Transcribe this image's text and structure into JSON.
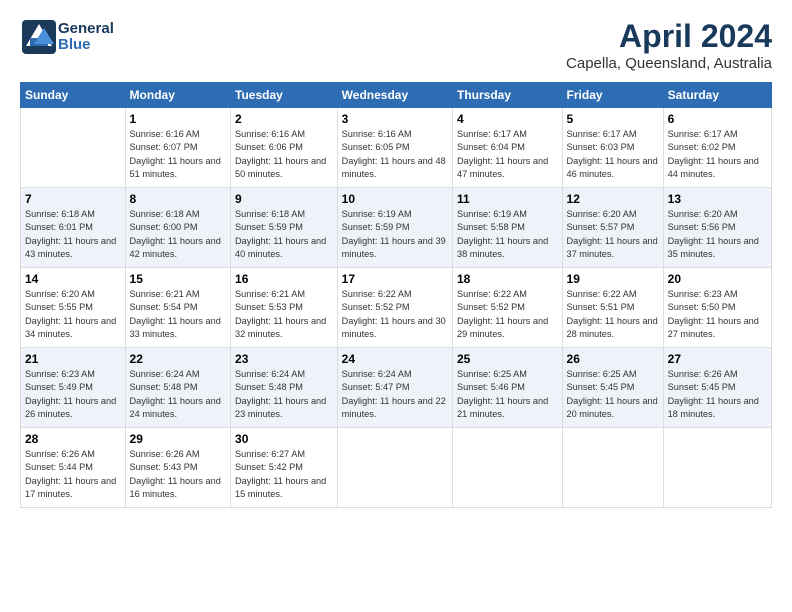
{
  "header": {
    "logo_line1": "General",
    "logo_line2": "Blue",
    "month": "April 2024",
    "location": "Capella, Queensland, Australia"
  },
  "days_of_week": [
    "Sunday",
    "Monday",
    "Tuesday",
    "Wednesday",
    "Thursday",
    "Friday",
    "Saturday"
  ],
  "weeks": [
    [
      {
        "num": "",
        "empty": true
      },
      {
        "num": "1",
        "sunrise": "Sunrise: 6:16 AM",
        "sunset": "Sunset: 6:07 PM",
        "daylight": "Daylight: 11 hours and 51 minutes."
      },
      {
        "num": "2",
        "sunrise": "Sunrise: 6:16 AM",
        "sunset": "Sunset: 6:06 PM",
        "daylight": "Daylight: 11 hours and 50 minutes."
      },
      {
        "num": "3",
        "sunrise": "Sunrise: 6:16 AM",
        "sunset": "Sunset: 6:05 PM",
        "daylight": "Daylight: 11 hours and 48 minutes."
      },
      {
        "num": "4",
        "sunrise": "Sunrise: 6:17 AM",
        "sunset": "Sunset: 6:04 PM",
        "daylight": "Daylight: 11 hours and 47 minutes."
      },
      {
        "num": "5",
        "sunrise": "Sunrise: 6:17 AM",
        "sunset": "Sunset: 6:03 PM",
        "daylight": "Daylight: 11 hours and 46 minutes."
      },
      {
        "num": "6",
        "sunrise": "Sunrise: 6:17 AM",
        "sunset": "Sunset: 6:02 PM",
        "daylight": "Daylight: 11 hours and 44 minutes."
      }
    ],
    [
      {
        "num": "7",
        "sunrise": "Sunrise: 6:18 AM",
        "sunset": "Sunset: 6:01 PM",
        "daylight": "Daylight: 11 hours and 43 minutes."
      },
      {
        "num": "8",
        "sunrise": "Sunrise: 6:18 AM",
        "sunset": "Sunset: 6:00 PM",
        "daylight": "Daylight: 11 hours and 42 minutes."
      },
      {
        "num": "9",
        "sunrise": "Sunrise: 6:18 AM",
        "sunset": "Sunset: 5:59 PM",
        "daylight": "Daylight: 11 hours and 40 minutes."
      },
      {
        "num": "10",
        "sunrise": "Sunrise: 6:19 AM",
        "sunset": "Sunset: 5:59 PM",
        "daylight": "Daylight: 11 hours and 39 minutes."
      },
      {
        "num": "11",
        "sunrise": "Sunrise: 6:19 AM",
        "sunset": "Sunset: 5:58 PM",
        "daylight": "Daylight: 11 hours and 38 minutes."
      },
      {
        "num": "12",
        "sunrise": "Sunrise: 6:20 AM",
        "sunset": "Sunset: 5:57 PM",
        "daylight": "Daylight: 11 hours and 37 minutes."
      },
      {
        "num": "13",
        "sunrise": "Sunrise: 6:20 AM",
        "sunset": "Sunset: 5:56 PM",
        "daylight": "Daylight: 11 hours and 35 minutes."
      }
    ],
    [
      {
        "num": "14",
        "sunrise": "Sunrise: 6:20 AM",
        "sunset": "Sunset: 5:55 PM",
        "daylight": "Daylight: 11 hours and 34 minutes."
      },
      {
        "num": "15",
        "sunrise": "Sunrise: 6:21 AM",
        "sunset": "Sunset: 5:54 PM",
        "daylight": "Daylight: 11 hours and 33 minutes."
      },
      {
        "num": "16",
        "sunrise": "Sunrise: 6:21 AM",
        "sunset": "Sunset: 5:53 PM",
        "daylight": "Daylight: 11 hours and 32 minutes."
      },
      {
        "num": "17",
        "sunrise": "Sunrise: 6:22 AM",
        "sunset": "Sunset: 5:52 PM",
        "daylight": "Daylight: 11 hours and 30 minutes."
      },
      {
        "num": "18",
        "sunrise": "Sunrise: 6:22 AM",
        "sunset": "Sunset: 5:52 PM",
        "daylight": "Daylight: 11 hours and 29 minutes."
      },
      {
        "num": "19",
        "sunrise": "Sunrise: 6:22 AM",
        "sunset": "Sunset: 5:51 PM",
        "daylight": "Daylight: 11 hours and 28 minutes."
      },
      {
        "num": "20",
        "sunrise": "Sunrise: 6:23 AM",
        "sunset": "Sunset: 5:50 PM",
        "daylight": "Daylight: 11 hours and 27 minutes."
      }
    ],
    [
      {
        "num": "21",
        "sunrise": "Sunrise: 6:23 AM",
        "sunset": "Sunset: 5:49 PM",
        "daylight": "Daylight: 11 hours and 26 minutes."
      },
      {
        "num": "22",
        "sunrise": "Sunrise: 6:24 AM",
        "sunset": "Sunset: 5:48 PM",
        "daylight": "Daylight: 11 hours and 24 minutes."
      },
      {
        "num": "23",
        "sunrise": "Sunrise: 6:24 AM",
        "sunset": "Sunset: 5:48 PM",
        "daylight": "Daylight: 11 hours and 23 minutes."
      },
      {
        "num": "24",
        "sunrise": "Sunrise: 6:24 AM",
        "sunset": "Sunset: 5:47 PM",
        "daylight": "Daylight: 11 hours and 22 minutes."
      },
      {
        "num": "25",
        "sunrise": "Sunrise: 6:25 AM",
        "sunset": "Sunset: 5:46 PM",
        "daylight": "Daylight: 11 hours and 21 minutes."
      },
      {
        "num": "26",
        "sunrise": "Sunrise: 6:25 AM",
        "sunset": "Sunset: 5:45 PM",
        "daylight": "Daylight: 11 hours and 20 minutes."
      },
      {
        "num": "27",
        "sunrise": "Sunrise: 6:26 AM",
        "sunset": "Sunset: 5:45 PM",
        "daylight": "Daylight: 11 hours and 18 minutes."
      }
    ],
    [
      {
        "num": "28",
        "sunrise": "Sunrise: 6:26 AM",
        "sunset": "Sunset: 5:44 PM",
        "daylight": "Daylight: 11 hours and 17 minutes."
      },
      {
        "num": "29",
        "sunrise": "Sunrise: 6:26 AM",
        "sunset": "Sunset: 5:43 PM",
        "daylight": "Daylight: 11 hours and 16 minutes."
      },
      {
        "num": "30",
        "sunrise": "Sunrise: 6:27 AM",
        "sunset": "Sunset: 5:42 PM",
        "daylight": "Daylight: 11 hours and 15 minutes."
      },
      {
        "num": "",
        "empty": true
      },
      {
        "num": "",
        "empty": true
      },
      {
        "num": "",
        "empty": true
      },
      {
        "num": "",
        "empty": true
      }
    ]
  ]
}
